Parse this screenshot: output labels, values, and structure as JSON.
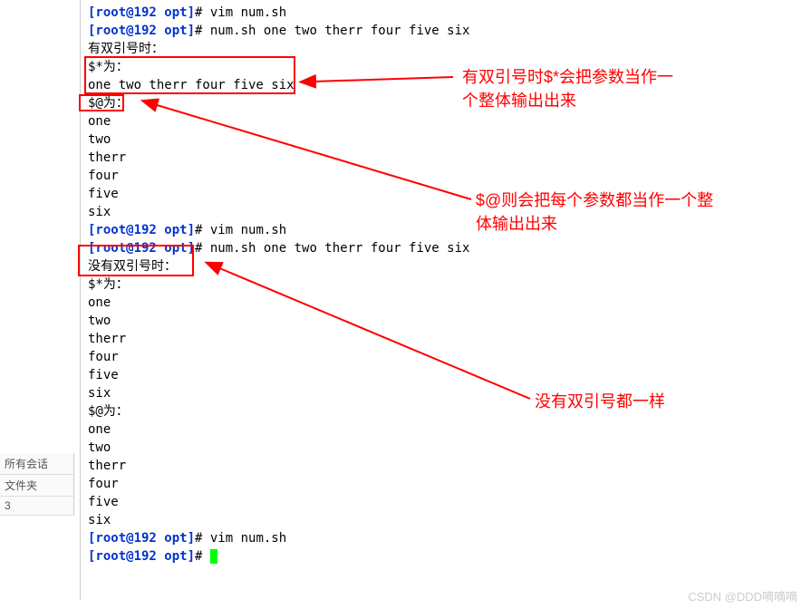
{
  "sidebar": {
    "items": [
      "所有会话",
      "文件夹",
      "3"
    ]
  },
  "terminal": {
    "prompt_user": "root@192",
    "prompt_dir": "opt",
    "lines": [
      {
        "type": "prompt",
        "cmd": "vim num.sh"
      },
      {
        "type": "prompt",
        "cmd": "num.sh one two therr four five six"
      },
      {
        "type": "out",
        "text": "有双引号时："
      },
      {
        "type": "out",
        "text": "$*为："
      },
      {
        "type": "out",
        "text": "one two therr four five six"
      },
      {
        "type": "out",
        "text": "$@为："
      },
      {
        "type": "out",
        "text": "one"
      },
      {
        "type": "out",
        "text": "two"
      },
      {
        "type": "out",
        "text": "therr"
      },
      {
        "type": "out",
        "text": "four"
      },
      {
        "type": "out",
        "text": "five"
      },
      {
        "type": "out",
        "text": "six"
      },
      {
        "type": "prompt",
        "cmd": "vim num.sh"
      },
      {
        "type": "prompt",
        "cmd": "num.sh one two therr four five six"
      },
      {
        "type": "out",
        "text": "没有双引号时："
      },
      {
        "type": "out",
        "text": "$*为："
      },
      {
        "type": "out",
        "text": "one"
      },
      {
        "type": "out",
        "text": "two"
      },
      {
        "type": "out",
        "text": "therr"
      },
      {
        "type": "out",
        "text": "four"
      },
      {
        "type": "out",
        "text": "five"
      },
      {
        "type": "out",
        "text": "six"
      },
      {
        "type": "out",
        "text": "$@为："
      },
      {
        "type": "out",
        "text": "one"
      },
      {
        "type": "out",
        "text": "two"
      },
      {
        "type": "out",
        "text": "therr"
      },
      {
        "type": "out",
        "text": "four"
      },
      {
        "type": "out",
        "text": "five"
      },
      {
        "type": "out",
        "text": "six"
      },
      {
        "type": "prompt",
        "cmd": "vim num.sh"
      },
      {
        "type": "prompt",
        "cmd": "",
        "cursor": true
      }
    ]
  },
  "annotations": {
    "a1_l1": "有双引号时$*会把参数当作一",
    "a1_l2": "个整体输出出来",
    "a2_l1": "$@则会把每个参数都当作一个整",
    "a2_l2": "体输出出来",
    "a3_l1": "没有双引号都一样"
  },
  "watermark": "CSDN @DDD嘀嘀嘀"
}
